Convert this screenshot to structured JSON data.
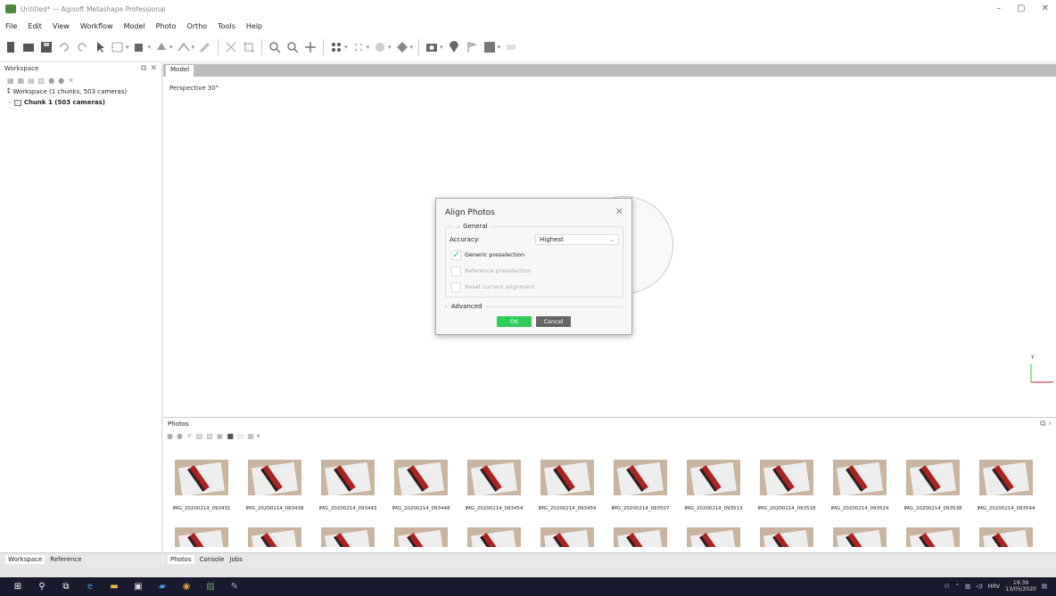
{
  "window": {
    "title": "Untitled* — Agisoft Metashape Professional"
  },
  "menu": [
    "File",
    "Edit",
    "View",
    "Workflow",
    "Model",
    "Photo",
    "Ortho",
    "Tools",
    "Help"
  ],
  "workspace": {
    "panel_title": "Workspace",
    "root_label": "Workspace (1 chunks, 503 cameras)",
    "chunk_label": "Chunk 1 (503 cameras)",
    "tabs": [
      "Workspace",
      "Reference"
    ]
  },
  "model": {
    "tab": "Model",
    "projection": "Perspective 30°"
  },
  "photos": {
    "panel_title": "Photos",
    "items": [
      "IMG_20200214_093431",
      "IMG_20200214_093438",
      "IMG_20200214_093443",
      "IMG_20200214_093448",
      "IMG_20200214_093454",
      "IMG_20200214_093459",
      "IMG_20200214_093507",
      "IMG_20200214_093513",
      "IMG_20200214_093518",
      "IMG_20200214_093524",
      "IMG_20200214_093538",
      "IMG_20200214_093544"
    ],
    "tabs": [
      "Photos",
      "Console",
      "Jobs"
    ]
  },
  "dialog": {
    "title": "Align Photos",
    "group_general": "General",
    "accuracy_label": "Accuracy:",
    "accuracy_value": "Highest",
    "generic_preselection": "Generic preselection",
    "generic_checked": true,
    "reference_preselection": "Reference preselection",
    "reset_alignment": "Reset current alignment",
    "group_advanced": "Advanced",
    "ok": "OK",
    "cancel": "Cancel"
  },
  "axis": {
    "y_label": "Y"
  },
  "taskbar": {
    "language": "HRV",
    "time": "19:39",
    "date": "13/05/2020"
  },
  "colors": {
    "accent": "#2ecc5a",
    "taskbar": "#1a1a2e"
  }
}
